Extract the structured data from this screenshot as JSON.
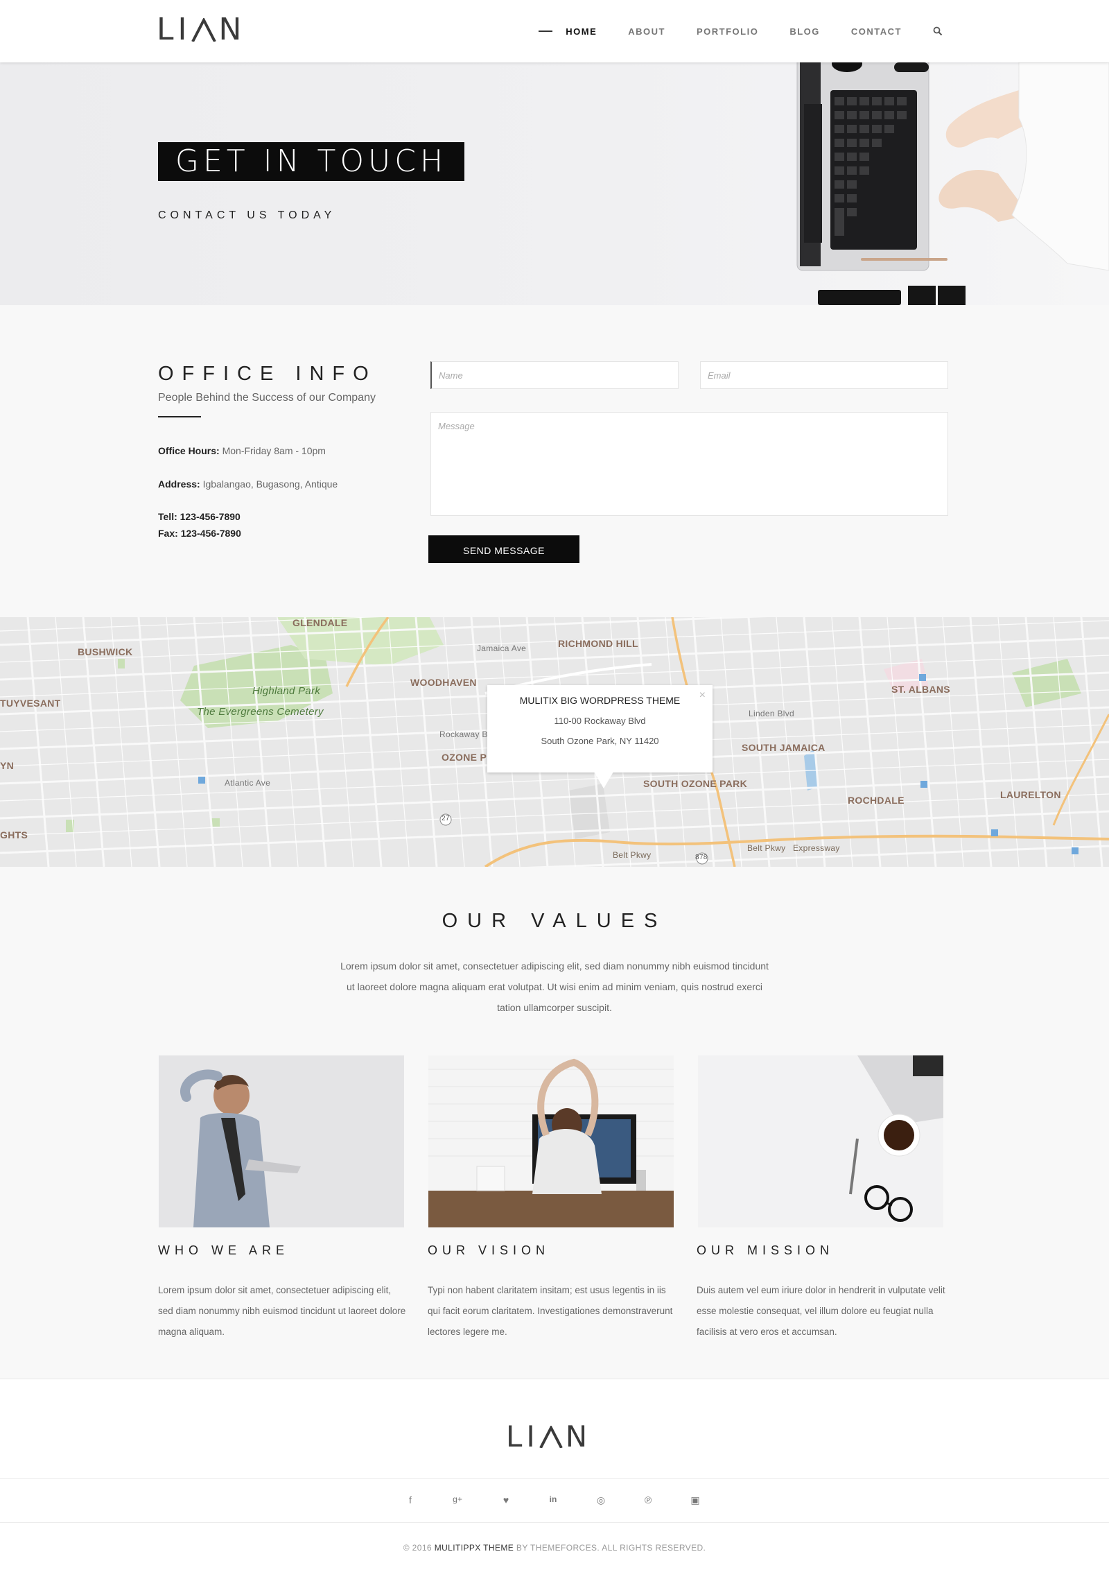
{
  "header": {
    "logo_text": "LIAN",
    "nav": [
      {
        "label": "HOME",
        "active": true
      },
      {
        "label": "ABOUT",
        "active": false
      },
      {
        "label": "PORTFOLIO",
        "active": false
      },
      {
        "label": "BLOG",
        "active": false
      },
      {
        "label": "CONTACT",
        "active": false
      }
    ],
    "search_icon": "search-icon"
  },
  "hero": {
    "title": "GET IN TOUCH",
    "subtitle": "CONTACT US TODAY"
  },
  "office": {
    "title": "OFFICE INFO",
    "subtitle": "People Behind the Success of our Company",
    "hours_label": "Office Hours:",
    "hours_value": "Mon-Friday 8am - 10pm",
    "address_label": "Address:",
    "address_value": "Igbalangao, Bugasong, Antique",
    "tel_label": "Tell:",
    "tel_value": "123-456-7890",
    "fax_label": "Fax:",
    "fax_value": "123-456-7890"
  },
  "form": {
    "name_placeholder": "Name",
    "email_placeholder": "Email",
    "message_placeholder": "Message",
    "send_label": "SEND MESSAGE"
  },
  "map": {
    "popup_title": "MULITIX BIG WORDPRESS THEME",
    "popup_line1": "110-00 Rockaway Blvd",
    "popup_line2": "South Ozone Park, NY 11420",
    "close_symbol": "×",
    "labels": {
      "bushwick": "BUSHWICK",
      "glendale": "GLENDALE",
      "richmond_hill": "RICHMOND HILL",
      "woodhaven": "WOODHAVEN",
      "st_albans": "ST. ALBANS",
      "stuyvesant": "TUYVESANT",
      "south_jamaica": "SOUTH JAMAICA",
      "south_ozone_park": "SOUTH OZONE PARK",
      "ozone": "OZONE P",
      "rochdale": "ROCHDALE",
      "laurelton": "LAURELTON",
      "heights": "GHTS",
      "yn": "YN",
      "highland_park": "Highland Park",
      "evergreens": "The Evergreens Cemetery",
      "belt_pkwy": "Belt Pkwy",
      "belt_pkwy_2": "Belt Pkwy",
      "expressway": "Expressway",
      "jamaica_ave": "Jamaica Ave",
      "atlantic_ave": "Atlantic Ave",
      "linden_blvd": "Linden Blvd",
      "rockaway_blvd": "Rockaway B",
      "route_27": "27",
      "route_878": "878"
    }
  },
  "values": {
    "title": "OUR VALUES",
    "text": "Lorem ipsum dolor sit amet, consectetuer adipiscing elit, sed diam nonummy nibh euismod tincidunt ut laoreet dolore magna aliquam erat volutpat. Ut wisi enim ad minim veniam, quis nostrud exerci tation ullamcorper suscipit.",
    "cards": [
      {
        "title": "WHO WE ARE",
        "text": "Lorem ipsum dolor sit amet, consectetuer adipiscing elit, sed diam nonummy nibh euismod tincidunt ut laoreet dolore magna aliquam."
      },
      {
        "title": "OUR VISION",
        "text": "Typi non habent claritatem insitam; est usus legentis in iis qui facit eorum claritatem. Investigationes demonstraverunt lectores legere me."
      },
      {
        "title": "OUR MISSION",
        "text": "Duis autem vel eum iriure dolor in hendrerit in vulputate velit esse molestie consequat, vel illum dolore eu feugiat nulla facilisis at vero eros et accumsan."
      }
    ]
  },
  "footer": {
    "logo_text": "LIAN",
    "social": [
      {
        "icon": "facebook-icon",
        "glyph": "f"
      },
      {
        "icon": "google-plus-icon",
        "glyph": "g+"
      },
      {
        "icon": "twitter-icon",
        "glyph": "♥"
      },
      {
        "icon": "linkedin-icon",
        "glyph": "in"
      },
      {
        "icon": "dribbble-icon",
        "glyph": "◎"
      },
      {
        "icon": "pinterest-icon",
        "glyph": "℗"
      },
      {
        "icon": "instagram-icon",
        "glyph": "▣"
      }
    ],
    "copy_prefix": "© 2016",
    "copy_brand": "MULITIPPX THEME",
    "copy_suffix": "BY THEMEFORCES. ALL RIGHTS RESERVED."
  }
}
